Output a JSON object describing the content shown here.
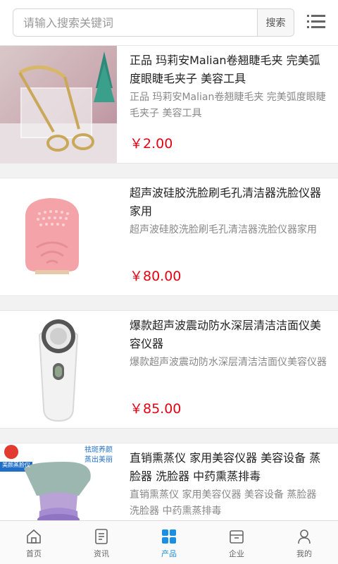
{
  "search": {
    "placeholder": "请输入搜索关键词",
    "button_label": "搜索"
  },
  "products": [
    {
      "title": "正品 玛莉安Malian卷翘睫毛夹 完美弧度眼睫毛夹子 美容工具",
      "desc": "正品 玛莉安Malian卷翘睫毛夹 完美弧度眼睫毛夹子 美容工具",
      "price": "￥2.00",
      "image": "eyelash-curler-image"
    },
    {
      "title": "超声波硅胶洗脸刷毛孔清洁器洗脸仪器家用",
      "desc": "超声波硅胶洗脸刷毛孔清洁器洗脸仪器家用",
      "price": "￥80.00",
      "image": "silicone-face-brush-image"
    },
    {
      "title": "爆款超声波震动防水深层清洁洁面仪美容仪器",
      "desc": "爆款超声波震动防水深层清洁洁面仪美容仪器",
      "price": "￥85.00",
      "image": "sonic-cleansing-brush-image"
    },
    {
      "title": "直销熏蒸仪 家用美容仪器 美容设备 蒸脸器 洗脸器 中药熏蒸排毒",
      "desc": "直销熏蒸仪 家用美容仪器 美容设备 蒸脸器 洗脸器 中药熏蒸排毒",
      "price": "",
      "image": "facial-steamer-image",
      "badge_left": "美颜蒸脸仪",
      "badge_right_1": "祛斑养颜",
      "badge_right_2": "蒸出美丽"
    }
  ],
  "tabbar": [
    {
      "label": "首页",
      "icon": "home-icon"
    },
    {
      "label": "资讯",
      "icon": "news-icon"
    },
    {
      "label": "产品",
      "icon": "grid-icon",
      "active": true
    },
    {
      "label": "企业",
      "icon": "company-icon"
    },
    {
      "label": "我的",
      "icon": "user-icon"
    }
  ],
  "colors": {
    "price": "#e60012",
    "accent": "#1a8fe3"
  }
}
